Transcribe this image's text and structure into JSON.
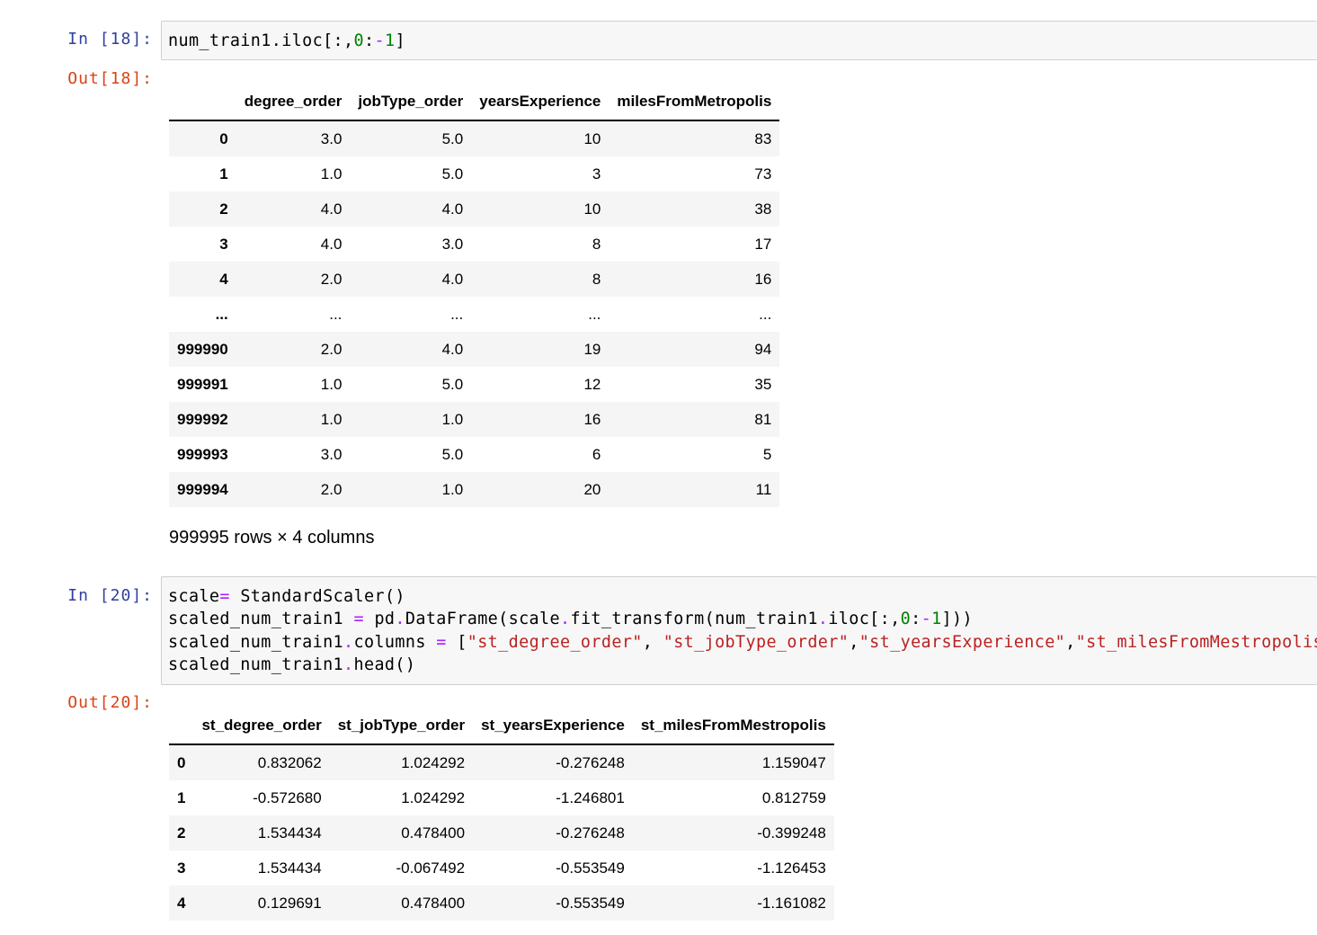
{
  "cells": {
    "in18": {
      "prompt": "In [18]:",
      "code": [
        [
          {
            "t": "num_train1.iloc[:,",
            "c": ""
          },
          {
            "t": "0",
            "c": "num"
          },
          {
            "t": ":",
            "c": ""
          },
          {
            "t": "-",
            "c": "op"
          },
          {
            "t": "1",
            "c": "num"
          },
          {
            "t": "]",
            "c": ""
          }
        ]
      ]
    },
    "out18": {
      "prompt": "Out[18]:",
      "columns": [
        "degree_order",
        "jobType_order",
        "yearsExperience",
        "milesFromMetropolis"
      ],
      "rows": [
        {
          "index": "0",
          "values": [
            "3.0",
            "5.0",
            "10",
            "83"
          ]
        },
        {
          "index": "1",
          "values": [
            "1.0",
            "5.0",
            "3",
            "73"
          ]
        },
        {
          "index": "2",
          "values": [
            "4.0",
            "4.0",
            "10",
            "38"
          ]
        },
        {
          "index": "3",
          "values": [
            "4.0",
            "3.0",
            "8",
            "17"
          ]
        },
        {
          "index": "4",
          "values": [
            "2.0",
            "4.0",
            "8",
            "16"
          ]
        },
        {
          "index": "...",
          "values": [
            "...",
            "...",
            "...",
            "..."
          ]
        },
        {
          "index": "999990",
          "values": [
            "2.0",
            "4.0",
            "19",
            "94"
          ]
        },
        {
          "index": "999991",
          "values": [
            "1.0",
            "5.0",
            "12",
            "35"
          ]
        },
        {
          "index": "999992",
          "values": [
            "1.0",
            "1.0",
            "16",
            "81"
          ]
        },
        {
          "index": "999993",
          "values": [
            "3.0",
            "5.0",
            "6",
            "5"
          ]
        },
        {
          "index": "999994",
          "values": [
            "2.0",
            "1.0",
            "20",
            "11"
          ]
        }
      ],
      "footnote": "999995 rows × 4 columns"
    },
    "in20": {
      "prompt": "In [20]:",
      "code": [
        [
          {
            "t": "scale",
            "c": ""
          },
          {
            "t": "=",
            "c": "op"
          },
          {
            "t": " StandardScaler()",
            "c": ""
          }
        ],
        [
          {
            "t": "scaled_num_train1 ",
            "c": ""
          },
          {
            "t": "=",
            "c": "op"
          },
          {
            "t": " pd",
            "c": ""
          },
          {
            "t": ".",
            "c": "op"
          },
          {
            "t": "DataFrame(scale",
            "c": ""
          },
          {
            "t": ".",
            "c": "op"
          },
          {
            "t": "fit_transform(num_train1",
            "c": ""
          },
          {
            "t": ".",
            "c": "op"
          },
          {
            "t": "iloc[:,",
            "c": ""
          },
          {
            "t": "0",
            "c": "num"
          },
          {
            "t": ":",
            "c": ""
          },
          {
            "t": "-",
            "c": "op"
          },
          {
            "t": "1",
            "c": "num"
          },
          {
            "t": "]))",
            "c": ""
          }
        ],
        [
          {
            "t": "scaled_num_train1",
            "c": ""
          },
          {
            "t": ".",
            "c": "op"
          },
          {
            "t": "columns ",
            "c": ""
          },
          {
            "t": "=",
            "c": "op"
          },
          {
            "t": " [",
            "c": ""
          },
          {
            "t": "\"st_degree_order\"",
            "c": "str"
          },
          {
            "t": ", ",
            "c": ""
          },
          {
            "t": "\"st_jobType_order\"",
            "c": "str"
          },
          {
            "t": ",",
            "c": ""
          },
          {
            "t": "\"st_yearsExperience\"",
            "c": "str"
          },
          {
            "t": ",",
            "c": ""
          },
          {
            "t": "\"st_milesFromMestropolis\"",
            "c": "str"
          },
          {
            "t": "]",
            "c": ""
          }
        ],
        [
          {
            "t": "scaled_num_train1",
            "c": ""
          },
          {
            "t": ".",
            "c": "op"
          },
          {
            "t": "head()",
            "c": ""
          }
        ]
      ]
    },
    "out20": {
      "prompt": "Out[20]:",
      "columns": [
        "st_degree_order",
        "st_jobType_order",
        "st_yearsExperience",
        "st_milesFromMestropolis"
      ],
      "rows": [
        {
          "index": "0",
          "values": [
            "0.832062",
            "1.024292",
            "-0.276248",
            "1.159047"
          ]
        },
        {
          "index": "1",
          "values": [
            "-0.572680",
            "1.024292",
            "-1.246801",
            "0.812759"
          ]
        },
        {
          "index": "2",
          "values": [
            "1.534434",
            "0.478400",
            "-0.276248",
            "-0.399248"
          ]
        },
        {
          "index": "3",
          "values": [
            "1.534434",
            "-0.067492",
            "-0.553549",
            "-1.126453"
          ]
        },
        {
          "index": "4",
          "values": [
            "0.129691",
            "0.478400",
            "-0.553549",
            "-1.161082"
          ]
        }
      ]
    }
  }
}
